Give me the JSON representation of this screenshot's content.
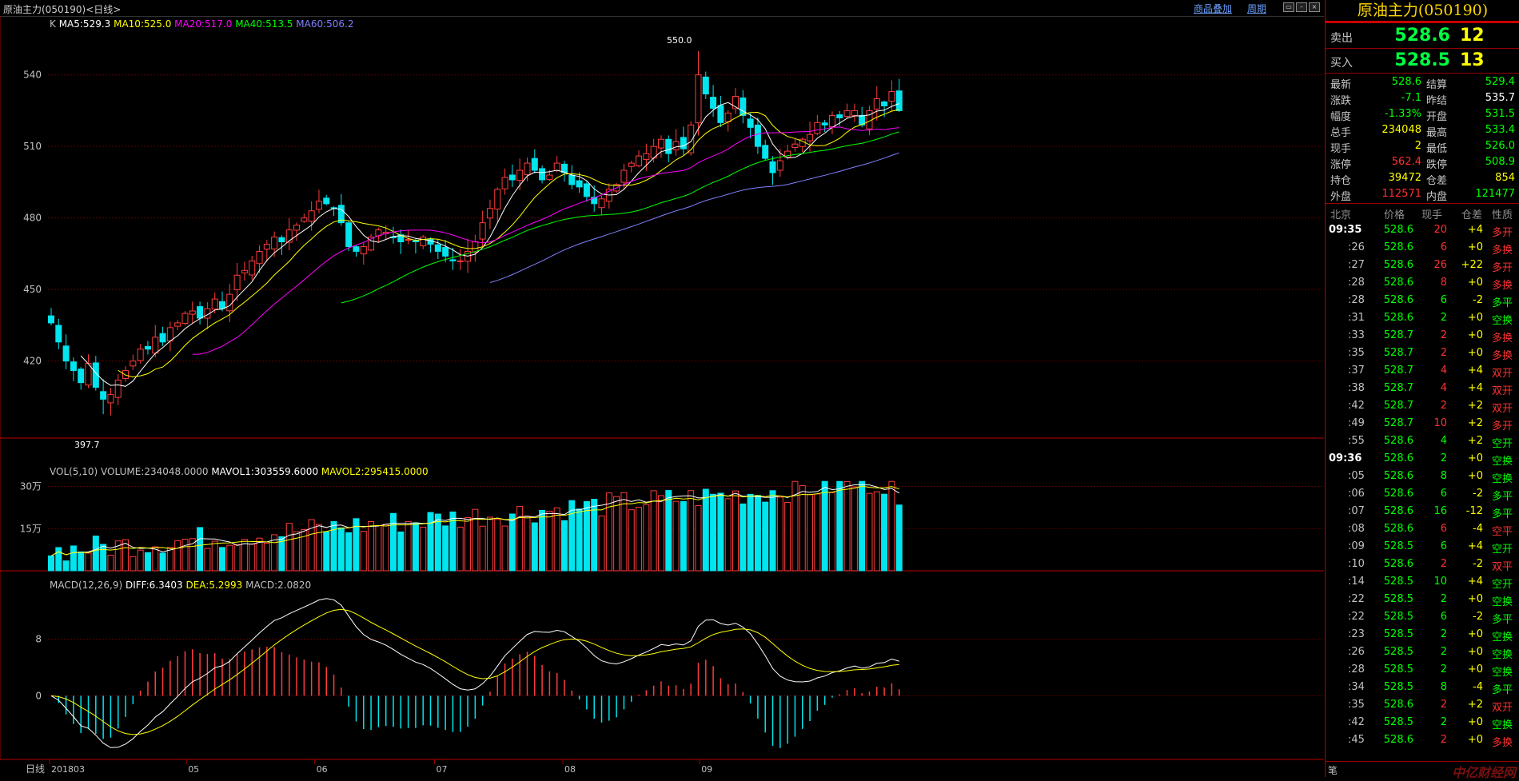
{
  "window": {
    "title": "原油主力(050190)<日线>",
    "overlay_link": "商品叠加",
    "period_link": "周期"
  },
  "legends": {
    "k": {
      "prefix": "K",
      "items": [
        {
          "text": "MA5:529.3",
          "color": "#ffffff"
        },
        {
          "text": "MA10:525.0",
          "color": "#ffff00"
        },
        {
          "text": "MA20:517.0",
          "color": "#ff00ff"
        },
        {
          "text": "MA40:513.5",
          "color": "#00ff00"
        },
        {
          "text": "MA60:506.2",
          "color": "#8080ff"
        }
      ]
    },
    "vol": {
      "items": [
        {
          "text": "VOL(5,10)",
          "color": "#c0c0c0"
        },
        {
          "text": "VOLUME:234048.0000",
          "color": "#c0c0c0"
        },
        {
          "text": "MAVOL1:303559.6000",
          "color": "#ffffff"
        },
        {
          "text": "MAVOL2:295415.0000",
          "color": "#ffff00"
        }
      ]
    },
    "macd": {
      "items": [
        {
          "text": "MACD(12,26,9)",
          "color": "#c0c0c0"
        },
        {
          "text": "DIFF:6.3403",
          "color": "#ffffff"
        },
        {
          "text": "DEA:5.2993",
          "color": "#ffff00"
        },
        {
          "text": "MACD:2.0820",
          "color": "#c0c0c0"
        }
      ]
    }
  },
  "axes": {
    "price_ticks": [
      "540",
      "510",
      "480",
      "450",
      "420"
    ],
    "vol_ticks": [
      "30万",
      "15万"
    ],
    "macd_ticks": [
      "8",
      "0"
    ],
    "period_label": "日线",
    "date_labels": [
      "201803",
      "05",
      "06",
      "07",
      "08",
      "09"
    ],
    "high_label": "550.0",
    "low_label": "397.7"
  },
  "chart_data": {
    "type": "candlestick",
    "price_range": [
      397.7,
      550.0
    ],
    "high": 550.0,
    "low": 397.7,
    "high_label": "550.0",
    "low_label": "397.7",
    "price_axis": [
      540,
      510,
      480,
      450,
      420
    ],
    "volume_axis": [
      "30万",
      "15万"
    ],
    "macd_axis": [
      8,
      0
    ],
    "ma": {
      "MA5": 529.3,
      "MA10": 525.0,
      "MA20": 517.0,
      "MA40": 513.5,
      "MA60": 506.2
    },
    "volume": {
      "VOLUME": 234048.0,
      "MAVOL1": 303559.6,
      "MAVOL2": 295415.0
    },
    "macd": {
      "DIFF": 6.3403,
      "DEA": 5.2993,
      "MACD": 2.082
    },
    "closes": [
      436,
      428,
      420,
      416,
      411,
      419,
      409,
      404,
      406,
      412,
      416,
      420,
      425,
      425,
      430,
      428,
      434,
      436,
      440,
      441,
      438,
      442,
      446,
      442,
      448,
      456,
      458,
      462,
      466,
      469,
      472,
      470,
      475,
      477,
      480,
      483,
      487,
      486,
      484,
      478,
      468,
      466,
      468,
      472,
      475,
      474,
      472,
      470,
      471,
      470,
      472,
      469,
      466,
      464,
      462,
      462,
      466,
      470,
      478,
      484,
      492,
      497,
      496,
      500,
      503,
      500,
      496,
      498,
      503,
      499,
      494,
      493,
      489,
      486,
      488,
      492,
      494,
      500,
      503,
      506,
      507,
      510,
      513,
      507,
      512,
      509,
      519,
      540,
      532,
      526,
      520,
      524,
      531,
      523,
      518,
      510,
      505,
      499,
      504,
      508,
      511,
      513,
      515,
      520,
      519,
      523,
      522,
      525,
      525,
      519,
      525,
      530,
      527,
      533,
      525
    ]
  },
  "quote": {
    "title": "原油主力(050190)",
    "sell": {
      "label": "卖出",
      "price": "528.6",
      "qty": "12"
    },
    "buy": {
      "label": "买入",
      "price": "528.5",
      "qty": "13"
    },
    "rows": [
      {
        "l1": "最新",
        "v1": "528.6",
        "c1": "#00ff00",
        "l2": "结算",
        "v2": "529.4",
        "c2": "#00ff00"
      },
      {
        "l1": "涨跌",
        "v1": "-7.1",
        "c1": "#00ff00",
        "l2": "昨结",
        "v2": "535.7",
        "c2": "#ffffff"
      },
      {
        "l1": "幅度",
        "v1": "-1.33%",
        "c1": "#00ff00",
        "l2": "开盘",
        "v2": "531.5",
        "c2": "#00ff00"
      },
      {
        "l1": "总手",
        "v1": "234048",
        "c1": "#ffff00",
        "l2": "最高",
        "v2": "533.4",
        "c2": "#00ff00"
      },
      {
        "l1": "现手",
        "v1": "2",
        "c1": "#ffff00",
        "l2": "最低",
        "v2": "526.0",
        "c2": "#00ff00"
      },
      {
        "l1": "涨停",
        "v1": "562.4",
        "c1": "#ff3030",
        "l2": "跌停",
        "v2": "508.9",
        "c2": "#00ff00"
      },
      {
        "l1": "持仓",
        "v1": "39472",
        "c1": "#ffff00",
        "l2": "仓差",
        "v2": "854",
        "c2": "#ffff00"
      },
      {
        "l1": "外盘",
        "v1": "112571",
        "c1": "#ff3030",
        "l2": "内盘",
        "v2": "121477",
        "c2": "#00ff00"
      }
    ]
  },
  "ticks": {
    "headers": [
      "北京",
      "价格",
      "现手",
      "仓差",
      "性质"
    ],
    "rows": [
      {
        "time": "09:35",
        "price": "528.6",
        "vol": "20",
        "diff": "+4",
        "nature": "多开",
        "vc": "#ff3030",
        "nc": "#ff3030",
        "big": true
      },
      {
        "time": ":26",
        "price": "528.6",
        "vol": "6",
        "diff": "+0",
        "nature": "多换",
        "vc": "#ff3030",
        "nc": "#ff3030"
      },
      {
        "time": ":27",
        "price": "528.6",
        "vol": "26",
        "diff": "+22",
        "nature": "多开",
        "vc": "#ff3030",
        "nc": "#ff3030"
      },
      {
        "time": ":28",
        "price": "528.6",
        "vol": "8",
        "diff": "+0",
        "nature": "多换",
        "vc": "#ff3030",
        "nc": "#ff3030"
      },
      {
        "time": ":28",
        "price": "528.6",
        "vol": "6",
        "diff": "-2",
        "nature": "多平",
        "vc": "#00ff00",
        "nc": "#00ff00"
      },
      {
        "time": ":31",
        "price": "528.6",
        "vol": "2",
        "diff": "+0",
        "nature": "空换",
        "vc": "#00ff00",
        "nc": "#00ff00"
      },
      {
        "time": ":33",
        "price": "528.7",
        "vol": "2",
        "diff": "+0",
        "nature": "多换",
        "vc": "#ff3030",
        "nc": "#ff3030"
      },
      {
        "time": ":35",
        "price": "528.7",
        "vol": "2",
        "diff": "+0",
        "nature": "多换",
        "vc": "#ff3030",
        "nc": "#ff3030"
      },
      {
        "time": ":37",
        "price": "528.7",
        "vol": "4",
        "diff": "+4",
        "nature": "双开",
        "vc": "#ff3030",
        "nc": "#ff3030"
      },
      {
        "time": ":38",
        "price": "528.7",
        "vol": "4",
        "diff": "+4",
        "nature": "双开",
        "vc": "#ff3030",
        "nc": "#ff3030"
      },
      {
        "time": ":42",
        "price": "528.7",
        "vol": "2",
        "diff": "+2",
        "nature": "双开",
        "vc": "#ff3030",
        "nc": "#ff3030"
      },
      {
        "time": ":49",
        "price": "528.7",
        "vol": "10",
        "diff": "+2",
        "nature": "多开",
        "vc": "#ff3030",
        "nc": "#ff3030"
      },
      {
        "time": ":55",
        "price": "528.6",
        "vol": "4",
        "diff": "+2",
        "nature": "空开",
        "vc": "#00ff00",
        "nc": "#00ff00"
      },
      {
        "time": "09:36",
        "price": "528.6",
        "vol": "2",
        "diff": "+0",
        "nature": "空换",
        "vc": "#00ff00",
        "nc": "#00ff00",
        "big": true
      },
      {
        "time": ":05",
        "price": "528.6",
        "vol": "8",
        "diff": "+0",
        "nature": "空换",
        "vc": "#00ff00",
        "nc": "#00ff00"
      },
      {
        "time": ":06",
        "price": "528.6",
        "vol": "6",
        "diff": "-2",
        "nature": "多平",
        "vc": "#00ff00",
        "nc": "#00ff00"
      },
      {
        "time": ":07",
        "price": "528.6",
        "vol": "16",
        "diff": "-12",
        "nature": "多平",
        "vc": "#00ff00",
        "nc": "#00ff00"
      },
      {
        "time": ":08",
        "price": "528.6",
        "vol": "6",
        "diff": "-4",
        "nature": "空平",
        "vc": "#ff3030",
        "nc": "#ff3030"
      },
      {
        "time": ":09",
        "price": "528.5",
        "vol": "6",
        "diff": "+4",
        "nature": "空开",
        "vc": "#00ff00",
        "nc": "#00ff00"
      },
      {
        "time": ":10",
        "price": "528.6",
        "vol": "2",
        "diff": "-2",
        "nature": "双平",
        "vc": "#ff3030",
        "nc": "#ff3030"
      },
      {
        "time": ":14",
        "price": "528.5",
        "vol": "10",
        "diff": "+4",
        "nature": "空开",
        "vc": "#00ff00",
        "nc": "#00ff00"
      },
      {
        "time": ":22",
        "price": "528.5",
        "vol": "2",
        "diff": "+0",
        "nature": "空换",
        "vc": "#00ff00",
        "nc": "#00ff00"
      },
      {
        "time": ":22",
        "price": "528.5",
        "vol": "6",
        "diff": "-2",
        "nature": "多平",
        "vc": "#00ff00",
        "nc": "#00ff00"
      },
      {
        "time": ":23",
        "price": "528.5",
        "vol": "2",
        "diff": "+0",
        "nature": "空换",
        "vc": "#00ff00",
        "nc": "#00ff00"
      },
      {
        "time": ":26",
        "price": "528.5",
        "vol": "2",
        "diff": "+0",
        "nature": "空换",
        "vc": "#00ff00",
        "nc": "#00ff00"
      },
      {
        "time": ":28",
        "price": "528.5",
        "vol": "2",
        "diff": "+0",
        "nature": "空换",
        "vc": "#00ff00",
        "nc": "#00ff00"
      },
      {
        "time": ":34",
        "price": "528.5",
        "vol": "8",
        "diff": "-4",
        "nature": "多平",
        "vc": "#00ff00",
        "nc": "#00ff00"
      },
      {
        "time": ":35",
        "price": "528.6",
        "vol": "2",
        "diff": "+2",
        "nature": "双开",
        "vc": "#ff3030",
        "nc": "#ff3030"
      },
      {
        "time": ":42",
        "price": "528.5",
        "vol": "2",
        "diff": "+0",
        "nature": "空换",
        "vc": "#00ff00",
        "nc": "#00ff00"
      },
      {
        "time": ":45",
        "price": "528.6",
        "vol": "2",
        "diff": "+0",
        "nature": "多换",
        "vc": "#ff3030",
        "nc": "#ff3030"
      }
    ]
  },
  "footer": {
    "tab": "笔",
    "watermark": "中亿财经网"
  }
}
